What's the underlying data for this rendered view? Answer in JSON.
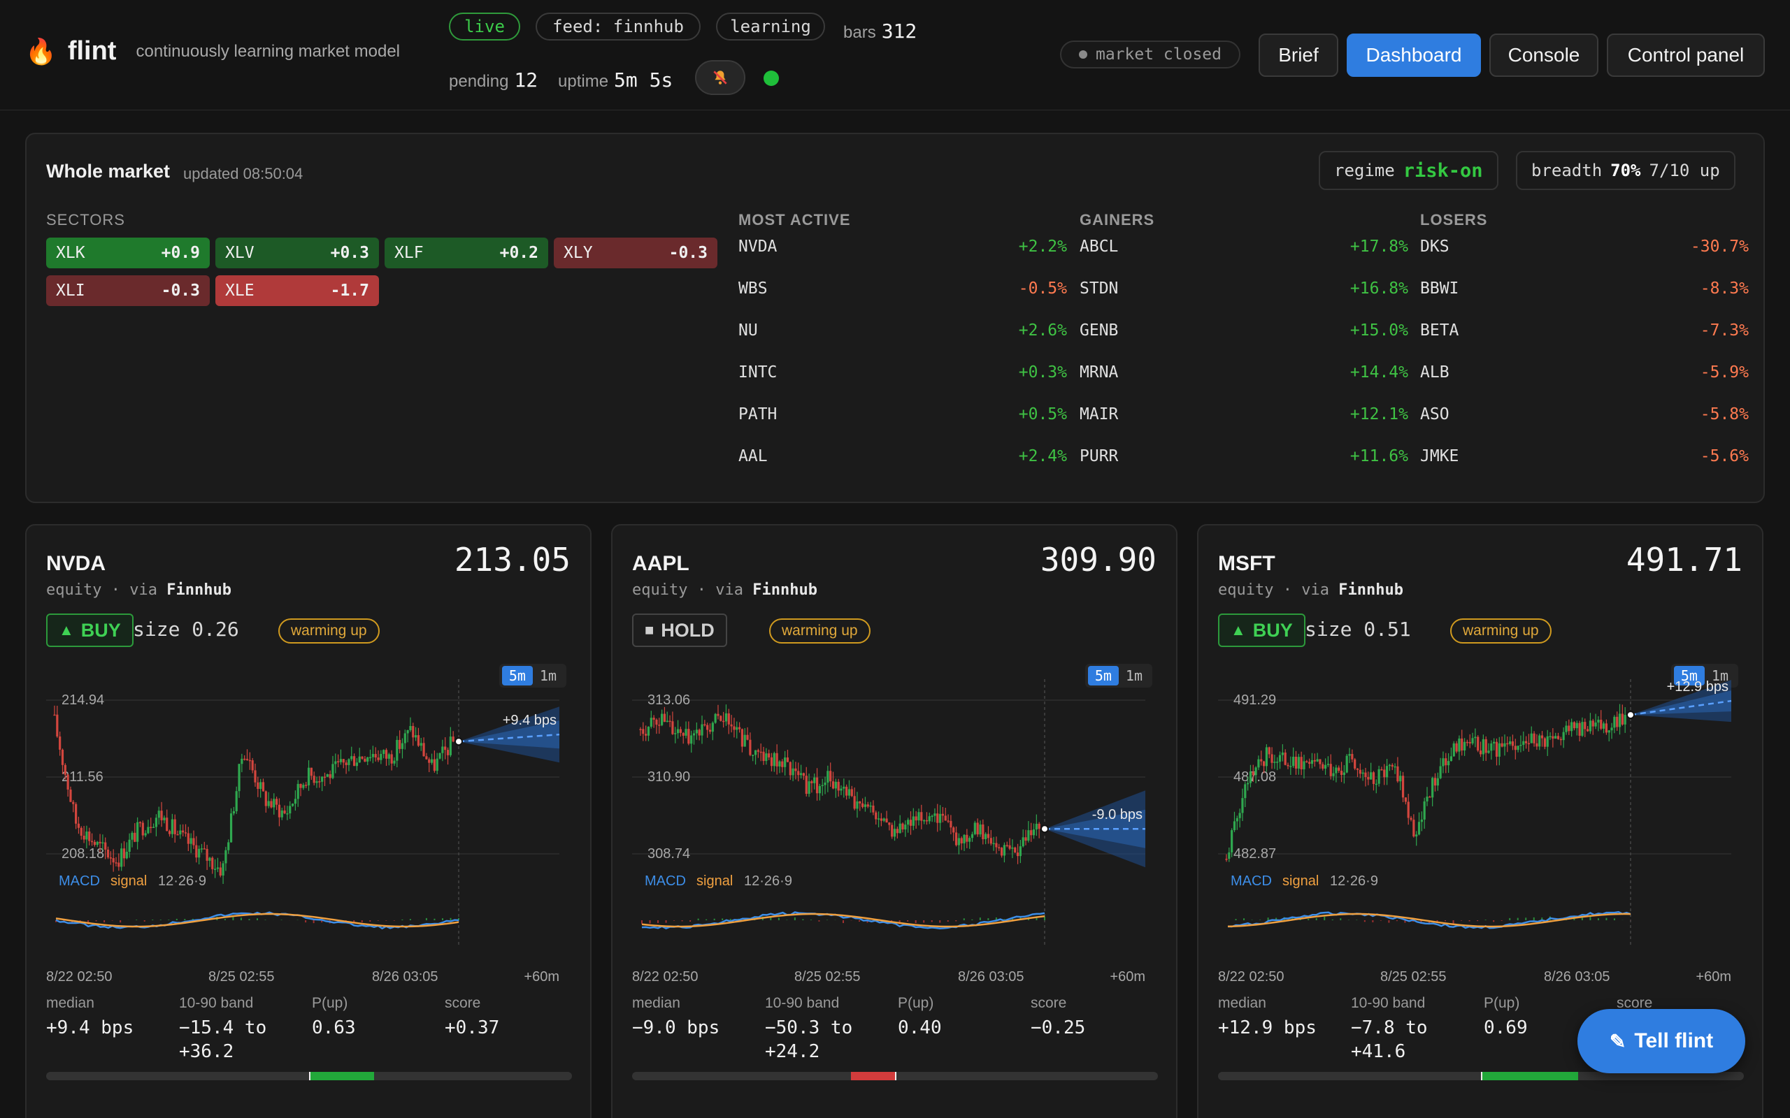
{
  "header": {
    "logo_icon": "flame-icon",
    "app_name": "flint",
    "tagline": "continuously learning market model",
    "pills": {
      "live": "live",
      "feed": "feed: finnhub",
      "learning": "learning"
    },
    "bars_label": "bars",
    "bars_value": "312",
    "pending_label": "pending",
    "pending_value": "12",
    "uptime_label": "uptime",
    "uptime_value": "5m 5s",
    "mute_icon": "bell-muted-icon",
    "market_status": "market closed",
    "nav": {
      "brief": "Brief",
      "dashboard": "Dashboard",
      "console": "Console",
      "control_panel": "Control panel"
    },
    "accent": "#2f7de0"
  },
  "market": {
    "title": "Whole market",
    "updated": "updated 08:50:04",
    "regime_label": "regime",
    "regime_value": "risk-on",
    "breadth_label": "breadth",
    "breadth_pct": "70%",
    "breadth_detail": "7/10 up",
    "sectors_label": "SECTORS",
    "sectors": [
      {
        "sym": "XLK",
        "val": "+0.9"
      },
      {
        "sym": "XLV",
        "val": "+0.3"
      },
      {
        "sym": "XLF",
        "val": "+0.2"
      },
      {
        "sym": "XLY",
        "val": "-0.3"
      },
      {
        "sym": "XLI",
        "val": "-0.3"
      },
      {
        "sym": "XLE",
        "val": "-1.7"
      }
    ],
    "most_active_label": "MOST ACTIVE",
    "most_active": [
      {
        "sym": "NVDA",
        "chg": "+2.2%"
      },
      {
        "sym": "WBS",
        "chg": "-0.5%"
      },
      {
        "sym": "NU",
        "chg": "+2.6%"
      },
      {
        "sym": "INTC",
        "chg": "+0.3%"
      },
      {
        "sym": "PATH",
        "chg": "+0.5%"
      },
      {
        "sym": "AAL",
        "chg": "+2.4%"
      }
    ],
    "gainers_label": "GAINERS",
    "gainers": [
      {
        "sym": "ABCL",
        "chg": "+17.8%"
      },
      {
        "sym": "STDN",
        "chg": "+16.8%"
      },
      {
        "sym": "GENB",
        "chg": "+15.0%"
      },
      {
        "sym": "MRNA",
        "chg": "+14.4%"
      },
      {
        "sym": "MAIR",
        "chg": "+12.1%"
      },
      {
        "sym": "PURR",
        "chg": "+11.6%"
      }
    ],
    "losers_label": "LOSERS",
    "losers": [
      {
        "sym": "DKS",
        "chg": "-30.7%"
      },
      {
        "sym": "BBWI",
        "chg": "-8.3%"
      },
      {
        "sym": "BETA",
        "chg": "-7.3%"
      },
      {
        "sym": "ALB",
        "chg": "-5.9%"
      },
      {
        "sym": "ASO",
        "chg": "-5.8%"
      },
      {
        "sym": "JMKE",
        "chg": "-5.6%"
      }
    ]
  },
  "cards": [
    {
      "sym": "NVDA",
      "price": "213.05",
      "type": "equity",
      "via_label": "· via",
      "via": "Finnhub",
      "signal": "BUY",
      "signal_kind": "buy",
      "size_label": "size",
      "size": "0.26",
      "status": "warming up",
      "tf_5m": "5m",
      "tf_1m": "1m",
      "y_ticks": [
        "214.94",
        "211.56",
        "208.18"
      ],
      "forecast_label": "+9.4 bps",
      "macd_label": "MACD",
      "signal_label": "signal",
      "macd_params": "12·26·9",
      "x_ticks": [
        "8/22 02:50",
        "8/25 02:55",
        "8/26 03:05",
        "+60m"
      ],
      "median_label": "median",
      "median": "+9.4 bps",
      "band_label": "10-90 band",
      "band_line1": "−15.4 to",
      "band_line2": "+36.2",
      "pup_label": "P(up)",
      "pup": "0.63",
      "score_label": "score",
      "score": "+0.37",
      "score_value": 0.37
    },
    {
      "sym": "AAPL",
      "price": "309.90",
      "type": "equity",
      "via_label": "· via",
      "via": "Finnhub",
      "signal": "HOLD",
      "signal_kind": "hold",
      "size_label": "",
      "size": "",
      "status": "warming up",
      "tf_5m": "5m",
      "tf_1m": "1m",
      "y_ticks": [
        "313.06",
        "310.90",
        "308.74"
      ],
      "forecast_label": "-9.0 bps",
      "macd_label": "MACD",
      "signal_label": "signal",
      "macd_params": "12·26·9",
      "x_ticks": [
        "8/22 02:50",
        "8/25 02:55",
        "8/26 03:05",
        "+60m"
      ],
      "median_label": "median",
      "median": "−9.0 bps",
      "band_label": "10-90 band",
      "band_line1": "−50.3 to",
      "band_line2": "+24.2",
      "pup_label": "P(up)",
      "pup": "0.40",
      "score_label": "score",
      "score": "−0.25",
      "score_value": -0.25
    },
    {
      "sym": "MSFT",
      "price": "491.71",
      "type": "equity",
      "via_label": "· via",
      "via": "Finnhub",
      "signal": "BUY",
      "signal_kind": "buy",
      "size_label": "size",
      "size": "0.51",
      "status": "warming up",
      "tf_5m": "5m",
      "tf_1m": "1m",
      "y_ticks": [
        "491.29",
        "487.08",
        "482.87"
      ],
      "forecast_label": "+12.9 bps",
      "macd_label": "MACD",
      "signal_label": "signal",
      "macd_params": "12·26·9",
      "x_ticks": [
        "8/22 02:50",
        "8/25 02:55",
        "8/26 03:05",
        "+60m"
      ],
      "median_label": "median",
      "median": "+12.9 bps",
      "band_label": "10-90 band",
      "band_line1": "−7.8 to",
      "band_line2": "+41.6",
      "pup_label": "P(up)",
      "pup": "0.69",
      "score_label": "score",
      "score": "",
      "score_value": 0.55
    }
  ],
  "tell_button": {
    "icon": "pencil-icon",
    "label": "Tell flint"
  },
  "colors": {
    "up": "#3fc244",
    "down": "#ff7a50",
    "candle_up": "#2fa84f",
    "candle_down": "#d3463e",
    "macd": "#3d8ee8",
    "signal": "#f0a040"
  }
}
